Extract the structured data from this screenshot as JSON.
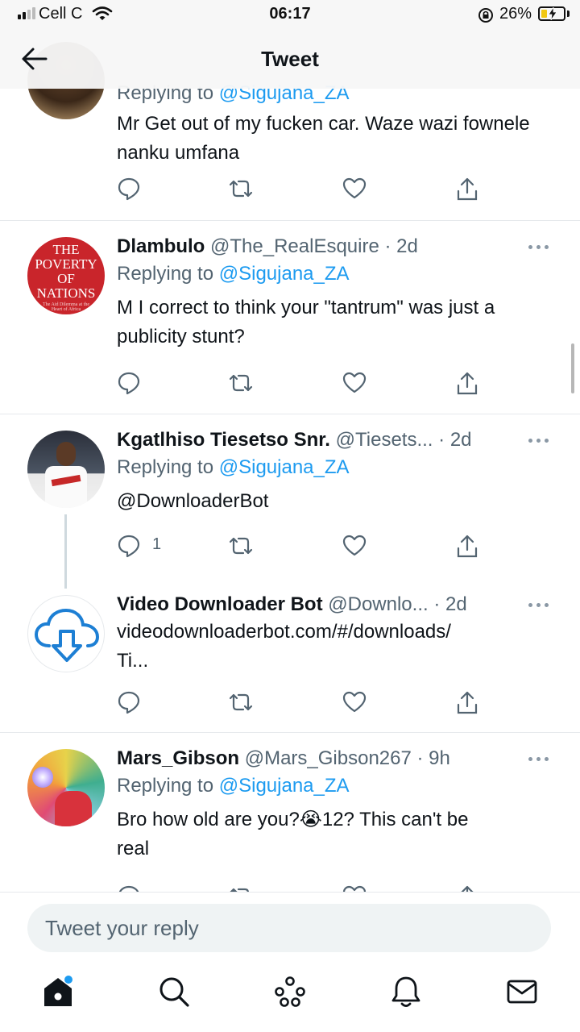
{
  "status_bar": {
    "carrier": "Cell C",
    "time": "06:17",
    "battery_percent": "26%",
    "battery_level": 0.26,
    "icons": [
      "signal-icon",
      "wifi-icon",
      "rotation-lock-icon",
      "battery-charging-icon"
    ]
  },
  "header": {
    "title": "Tweet",
    "back_icon": "back-arrow-icon"
  },
  "tweets": [
    {
      "replying_prefix": "Replying to ",
      "replying_to": "@Sigujana_ZA",
      "text": "Mr Get out of my fucken car. Waze wazi fownele nanku umfana"
    },
    {
      "name": "Dlambulo",
      "handle_time": "@The_RealEsquire · 2d",
      "replying_prefix": "Replying to ",
      "replying_to": "@Sigujana_ZA",
      "text": "M I correct to think your \"tantrum\" was just a publicity stunt?",
      "avatar_text": {
        "line1": "THE",
        "line2": "POVERTY",
        "line3": "OF",
        "line4": "NATIONS",
        "line5": "The Aid Dilemma at the",
        "line6": "Heart of Africa"
      }
    },
    {
      "name": "Kgatlhiso Tiesetso Snr.",
      "handle": "@Tiesets...",
      "time": "· 2d",
      "replying_prefix": "Replying to ",
      "replying_to": "@Sigujana_ZA",
      "text": "@DownloaderBot",
      "reply_count": "1"
    },
    {
      "name": "Video Downloader Bot",
      "handle": "@Downlo...",
      "time": "· 2d",
      "link_line1": "videodownloaderbot.com/#/downloads/",
      "link_line2": "Ti..."
    },
    {
      "name": "Mars_Gibson",
      "handle_time": "@Mars_Gibson267 · 9h",
      "replying_prefix": "Replying to ",
      "replying_to": "@Sigujana_ZA",
      "text_line1": "Bro how old are you?😭12? This can't be",
      "text_line2": "real"
    }
  ],
  "actions": [
    "reply-icon",
    "retweet-icon",
    "like-icon",
    "share-icon"
  ],
  "reply_box": {
    "placeholder": "Tweet your reply"
  },
  "tabbar": {
    "items": [
      "home-icon",
      "search-icon",
      "spaces-icon",
      "notifications-icon",
      "messages-icon"
    ]
  },
  "colors": {
    "link": "#1d9bf0",
    "secondary_text": "#536471",
    "divider": "#e6e9ec"
  }
}
